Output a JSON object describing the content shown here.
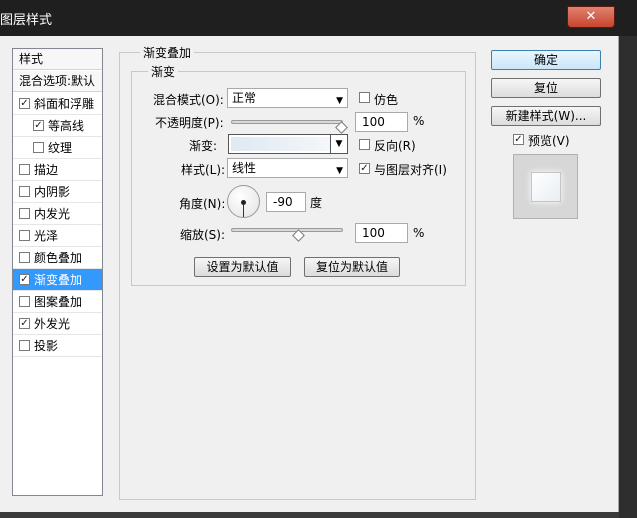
{
  "window": {
    "title": "图层样式",
    "close_glyph": "✕"
  },
  "sidebar": {
    "header": "样式",
    "blend_options": "混合选项:默认",
    "items": [
      {
        "label": "斜面和浮雕",
        "checked": true,
        "indent": false,
        "selected": false
      },
      {
        "label": "等高线",
        "checked": true,
        "indent": true,
        "selected": false
      },
      {
        "label": "纹理",
        "checked": false,
        "indent": true,
        "selected": false
      },
      {
        "label": "描边",
        "checked": false,
        "indent": false,
        "selected": false
      },
      {
        "label": "内阴影",
        "checked": false,
        "indent": false,
        "selected": false
      },
      {
        "label": "内发光",
        "checked": false,
        "indent": false,
        "selected": false
      },
      {
        "label": "光泽",
        "checked": false,
        "indent": false,
        "selected": false
      },
      {
        "label": "颜色叠加",
        "checked": false,
        "indent": false,
        "selected": false
      },
      {
        "label": "渐变叠加",
        "checked": true,
        "indent": false,
        "selected": true
      },
      {
        "label": "图案叠加",
        "checked": false,
        "indent": false,
        "selected": false
      },
      {
        "label": "外发光",
        "checked": true,
        "indent": false,
        "selected": false
      },
      {
        "label": "投影",
        "checked": false,
        "indent": false,
        "selected": false
      }
    ]
  },
  "panel": {
    "outer_title": "渐变叠加",
    "inner_title": "渐变",
    "blend_mode_label": "混合模式(O):",
    "blend_mode_value": "正常",
    "dither_label": "仿色",
    "dither_checked": false,
    "opacity_label": "不透明度(P):",
    "opacity_value": "100",
    "opacity_unit": "%",
    "gradient_label": "渐变:",
    "reverse_label": "反向(R)",
    "reverse_checked": false,
    "style_label": "样式(L):",
    "style_value": "线性",
    "align_label": "与图层对齐(I)",
    "align_checked": true,
    "angle_label": "角度(N):",
    "angle_value": "-90",
    "angle_unit": "度",
    "scale_label": "缩放(S):",
    "scale_value": "100",
    "scale_unit": "%",
    "make_default": "设置为默认值",
    "reset_default": "复位为默认值"
  },
  "buttons": {
    "ok": "确定",
    "reset": "复位",
    "new_style": "新建样式(W)...",
    "preview_label": "预览(V)",
    "preview_checked": true
  },
  "glyphs": {
    "check": "✓",
    "down": "▼"
  }
}
